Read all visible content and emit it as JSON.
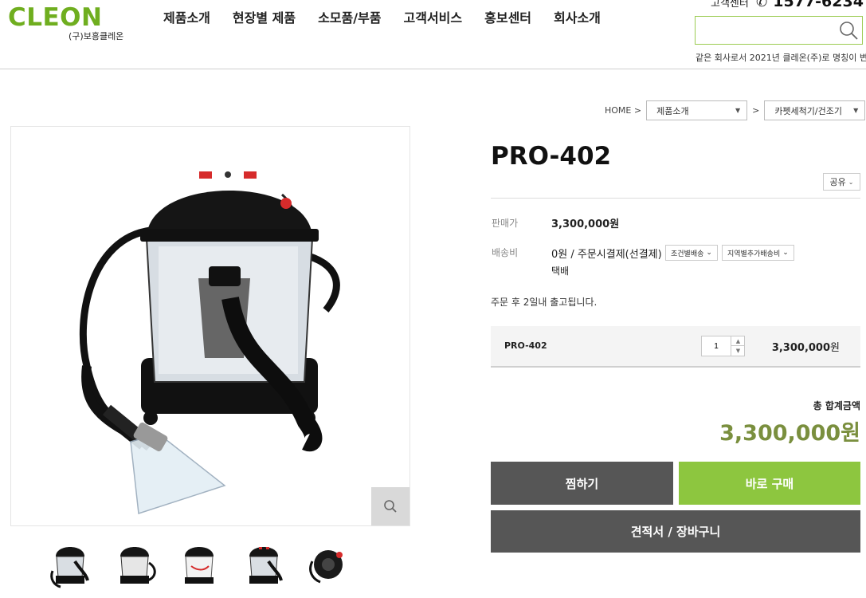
{
  "header": {
    "logo": "CLEON",
    "logo_sub": "(구)보흥클레온",
    "nav": [
      "제품소개",
      "현장별 제품",
      "소모품/부품",
      "고객서비스",
      "홍보센터",
      "회사소개"
    ],
    "cs_label": "고객센터",
    "cs_phone": "1577-6234",
    "search_value": "",
    "ticker": "같은 회사로서 2021년 클레온(주)로 명칭이 변"
  },
  "breadcrumb": {
    "home": "HOME >",
    "category": "제품소개",
    "separator": ">",
    "subcategory": "카펫세척기/건조기"
  },
  "product": {
    "name": "PRO-402",
    "share_label": "공유",
    "price_label": "판매가",
    "price": "3,300,000원",
    "shipping_label": "배송비",
    "shipping_value": "0원  / 주문시결제(선결제)",
    "shipping_tags": [
      "조건별배송",
      "지역별추가배송비"
    ],
    "shipping_method": "택배",
    "notice": "주문 후 2일내 출고됩니다.",
    "option": {
      "name": "PRO-402",
      "quantity": "1",
      "price_number": "3,300,000",
      "price_unit": "원"
    },
    "total_label": "총 합계금액",
    "total_value": "3,300,000원"
  },
  "buttons": {
    "wish": "찜하기",
    "buy": "바로 구매",
    "cart": "견적서 / 장바구니"
  },
  "colors": {
    "brand_green": "#6fae1f",
    "buy_green": "#8dc63f",
    "total_olive": "#7a8f3e",
    "dark_button": "#565656"
  },
  "icons": [
    "search-icon",
    "phone-icon",
    "zoom-icon",
    "chevron-down-icon"
  ]
}
